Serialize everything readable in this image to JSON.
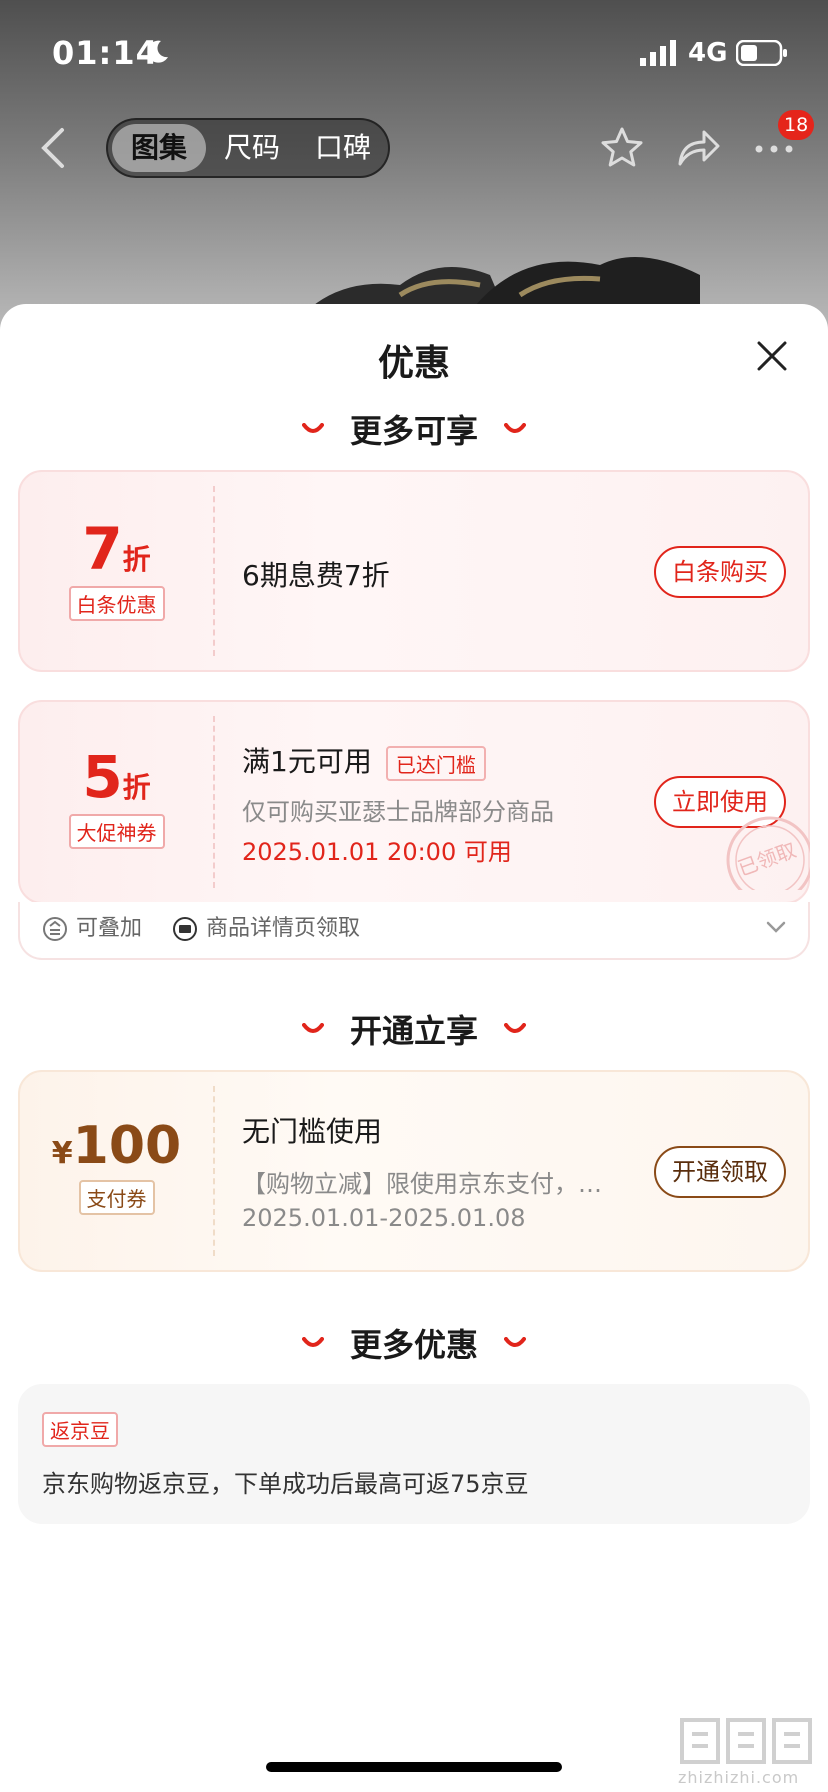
{
  "status_bar": {
    "time": "01:14",
    "network": "4G"
  },
  "nav": {
    "tabs": [
      "图集",
      "尺码",
      "口碑"
    ],
    "active_tab": 0,
    "cart_badge": "18"
  },
  "sheet": {
    "title": "优惠"
  },
  "sections": {
    "more_available": "更多可享",
    "activate": "开通立享",
    "more_offers": "更多优惠"
  },
  "baitiao": {
    "value": "7",
    "unit": "折",
    "tag": "白条优惠",
    "desc": "6期息费7折",
    "button": "白条购买"
  },
  "promo_coupon": {
    "value": "5",
    "unit": "折",
    "tag": "大促神券",
    "condition": "满1元可用",
    "status": "已达门槛",
    "scope": "仅可购买亚瑟士品牌部分商品",
    "time": "2025.01.01 20:00 可用",
    "button": "立即使用",
    "stamp": "已领取",
    "footer": {
      "stackable": "可叠加",
      "source": "商品详情页领取"
    }
  },
  "pay_coupon": {
    "currency": "¥",
    "value": "100",
    "tag": "支付券",
    "title": "无门槛使用",
    "desc": "【购物立减】限使用京东支付，…",
    "validity": "2025.01.01-2025.01.08",
    "button": "开通领取"
  },
  "jingdou": {
    "tag": "返京豆",
    "desc": "京东购物返京豆，下单成功后最高可返75京豆"
  },
  "watermark": {
    "site": "zhizhizhi.com"
  },
  "colors": {
    "accent": "#e1251b",
    "gold": "#8a4a17"
  }
}
